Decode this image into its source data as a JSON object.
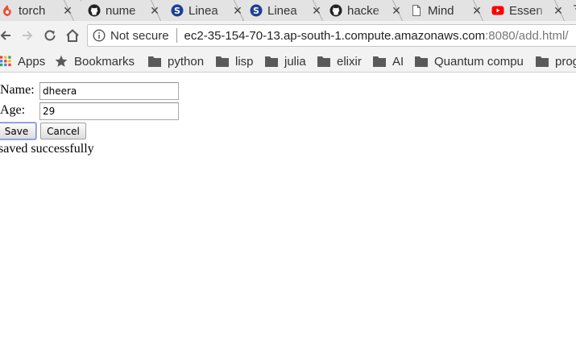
{
  "tabs": [
    {
      "title": "torch",
      "icon": "fire-icon"
    },
    {
      "title": "nume",
      "icon": "github-icon"
    },
    {
      "title": "Linea",
      "icon": "s-logo-icon"
    },
    {
      "title": "Linea",
      "icon": "s-logo-icon"
    },
    {
      "title": "hacke",
      "icon": "github-icon"
    },
    {
      "title": "Mind",
      "icon": "page-icon"
    },
    {
      "title": "Essen",
      "icon": "youtube-icon"
    }
  ],
  "tab_close_glyph": "✕",
  "toolbar": {
    "security_label": "Not secure",
    "url_host": "ec2-35-154-70-13.ap-south-1.compute.amazonaws.com",
    "url_rest": ":8080/add.html/"
  },
  "bookmarks": {
    "apps": "Apps",
    "bookmarks": "Bookmarks",
    "folders": [
      "python",
      "lisp",
      "julia",
      "elixir",
      "AI",
      "Quantum compu",
      "prog"
    ]
  },
  "form": {
    "name_label": "Name:",
    "name_value": "dheera",
    "age_label": "Age:",
    "age_value": "29",
    "save_label": "Save",
    "cancel_label": "Cancel",
    "status_message": "saved successfully"
  },
  "colors": {
    "tab_bg": "#e3e3e3",
    "toolbar_bg": "#f2f2f2",
    "youtube_red": "#ff0000",
    "torch_orange": "#ee4c2c",
    "s_logo_blue": "#1e3f94"
  }
}
